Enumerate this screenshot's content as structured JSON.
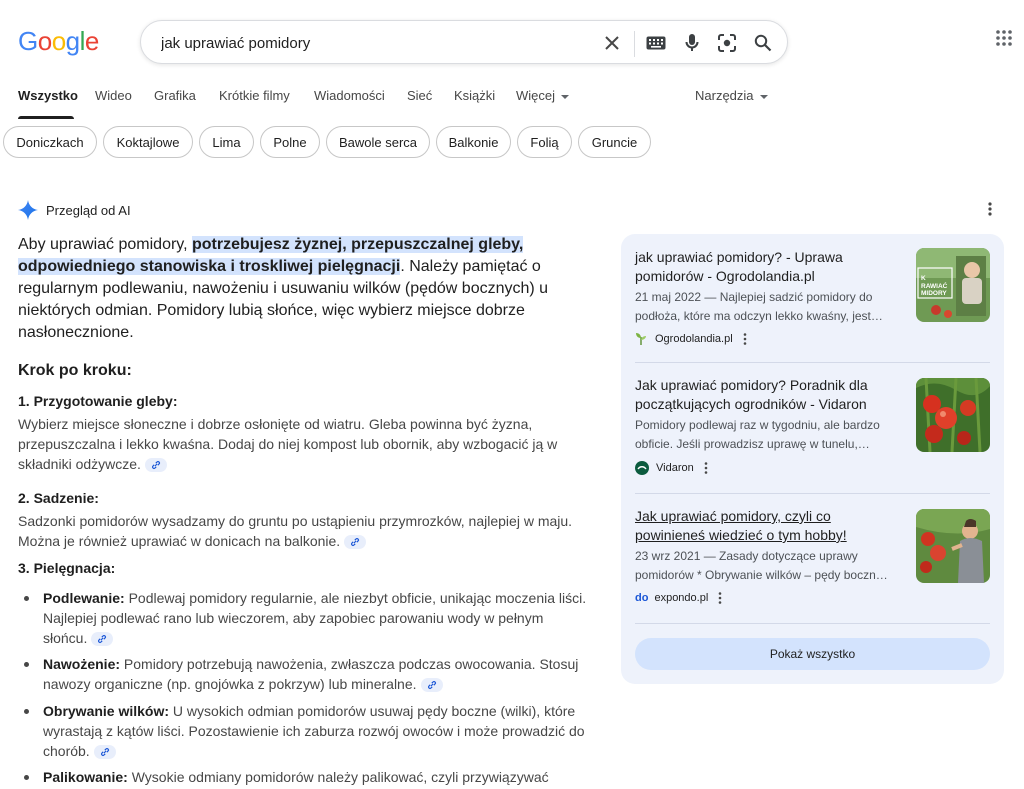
{
  "header": {
    "logo_letters": [
      {
        "ch": "G",
        "color": "#4285f4"
      },
      {
        "ch": "o",
        "color": "#ea4335"
      },
      {
        "ch": "o",
        "color": "#fbbc05"
      },
      {
        "ch": "g",
        "color": "#4285f4"
      },
      {
        "ch": "l",
        "color": "#34a853"
      },
      {
        "ch": "e",
        "color": "#ea4335"
      }
    ],
    "search_value": "jak uprawiać pomidory"
  },
  "tabs": {
    "items": [
      "Wszystko",
      "Wideo",
      "Grafika",
      "Krótkie filmy",
      "Wiadomości",
      "Sieć",
      "Książki",
      "Więcej"
    ],
    "active": "Wszystko",
    "tools_label": "Narzędzia"
  },
  "chips": [
    "Doniczkach",
    "Koktajlowe",
    "Lima",
    "Polne",
    "Bawole serca",
    "Balkonie",
    "Folią",
    "Gruncie"
  ],
  "ai_overview": {
    "title": "Przegląd od AI",
    "summary_before": "Aby uprawiać pomidory, ",
    "summary_highlight": "potrzebujesz żyznej, przepuszczalnej gleby, odpowiedniego stanowiska i troskliwej pielęgnacji",
    "summary_after": ". Należy pamiętać o regularnym podlewaniu, nawożeniu i usuwaniu wilków (pędów bocznych) u niektórych odmian. Pomidory lubią słońce, więc wybierz miejsce dobrze nasłonecznione.",
    "steps_heading": "Krok po kroku:",
    "sections": [
      {
        "title": "1. Przygotowanie gleby:",
        "text": "Wybierz miejsce słoneczne i dobrze osłonięte od wiatru. Gleba powinna być żyzna, przepuszczalna i lekko kwaśna. Dodaj do niej kompost lub obornik, aby wzbogacić ją w składniki odżywcze."
      },
      {
        "title": "2. Sadzenie:",
        "text": "Sadzonki pomidorów wysadzamy do gruntu po ustąpieniu przymrozków, najlepiej w maju. Można je również uprawiać w donicach na balkonie."
      },
      {
        "title": "3. Pielęgnacja:",
        "text": ""
      }
    ],
    "bullets": [
      {
        "term": "Podlewanie:",
        "text": " Podlewaj pomidory regularnie, ale niezbyt obficie, unikając moczenia liści. Najlepiej podlewać rano lub wieczorem, aby zapobiec parowaniu wody w pełnym słońcu."
      },
      {
        "term": "Nawożenie:",
        "text": " Pomidory potrzebują nawożenia, zwłaszcza podczas owocowania. Stosuj nawozy organiczne (np. gnojówka z pokrzyw) lub mineralne."
      },
      {
        "term": "Obrywanie wilków:",
        "text": " U wysokich odmian pomidorów usuwaj pędy boczne (wilki), które wyrastają z kątów liści. Pozostawienie ich zaburza rozwój owoców i może prowadzić do chorób."
      },
      {
        "term": "Palikowanie:",
        "text": " Wysokie odmiany pomidorów należy palikować, czyli przywiązywać"
      }
    ]
  },
  "sources": {
    "items": [
      {
        "title": "jak uprawiać pomidory? - Uprawa pomidorów - Ogrodolandia.pl",
        "snippet": "21 maj 2022 — Najlepiej sadzić pomidory do podłoża, które ma odczyn lekko kwaśny, jest…",
        "site": "Ogrodolandia.pl",
        "thumb_text": "JAK UPRAWIAĆ POMIDORY"
      },
      {
        "title": "Jak uprawiać pomidory? Poradnik dla początkujących ogrodników - Vidaron",
        "snippet": "Pomidory podlewaj raz w tygodniu, ale bardzo obficie. Jeśli prowadzisz uprawę w tunelu,…",
        "site": "Vidaron",
        "thumb_text": ""
      },
      {
        "title": "Jak uprawiać pomidory, czyli co powinieneś wiedzieć o tym hobby!",
        "snippet": "23 wrz 2021 — Zasady dotyczące uprawy pomidorów * Obrywanie wilków – pędy boczn…",
        "site": "expondo.pl",
        "site_logo": "do",
        "thumb_text": ""
      }
    ],
    "show_all": "Pokaż wszystko"
  },
  "colors": {
    "highlight": "#d3e3fd",
    "panel": "#eef2fb",
    "expondo": "#1a56d6",
    "vidaron": "#0b5b3e"
  }
}
